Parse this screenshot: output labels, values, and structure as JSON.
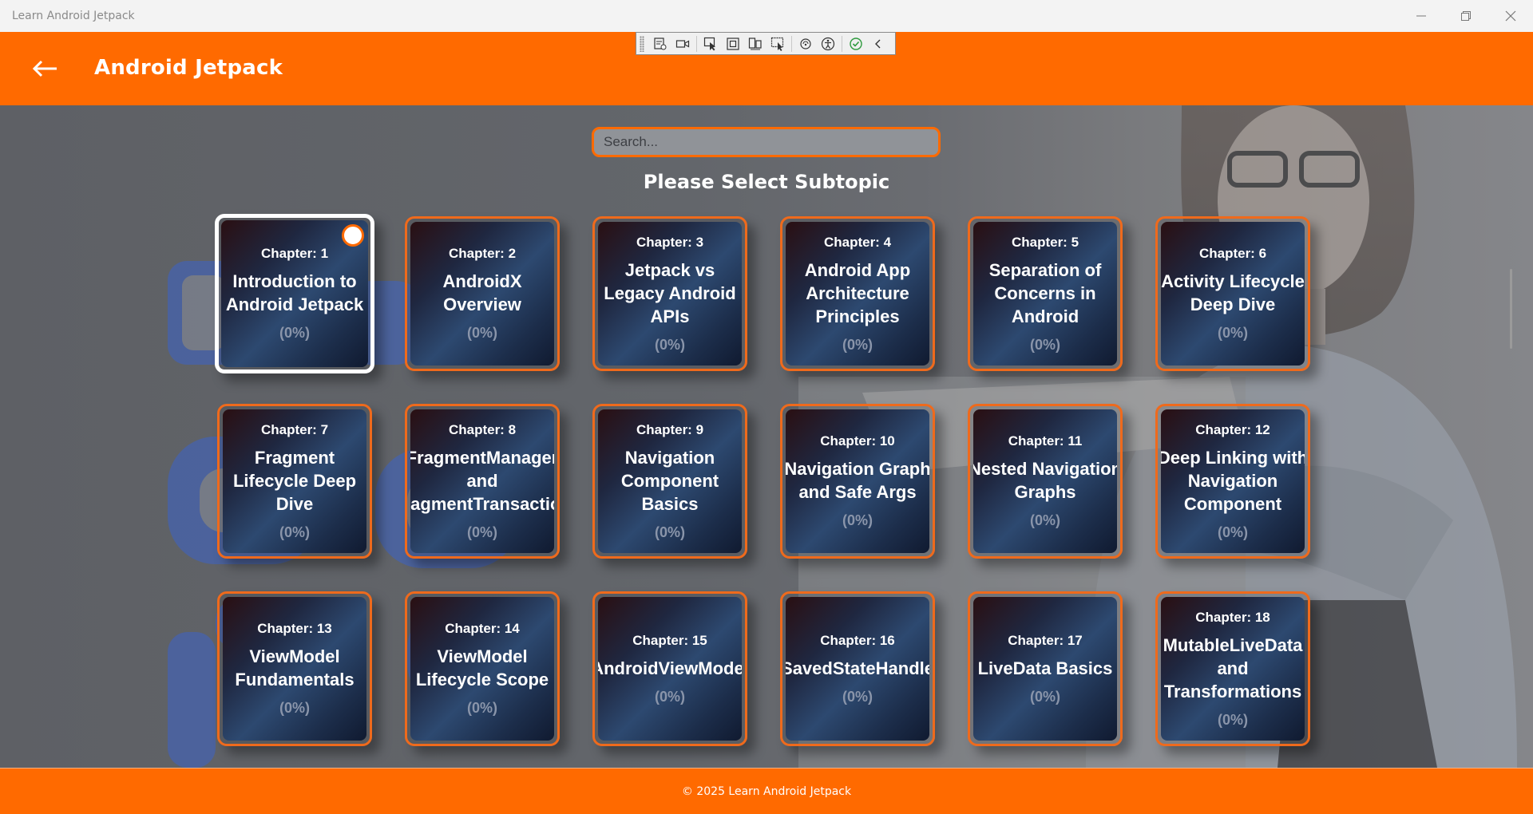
{
  "window": {
    "title": "Learn Android Jetpack",
    "minimize_icon": "minimize-icon",
    "maximize_icon": "restore-icon",
    "close_icon": "close-icon"
  },
  "header": {
    "title": "Android Jetpack",
    "back_icon": "arrow-left-icon"
  },
  "dev_toolbar": {
    "tools": [
      "grip",
      "live-visual-tree-icon",
      "video-icon",
      "select-element-icon",
      "display-layout-adorners-icon",
      "track-focus-icon",
      "preview-selection-icon",
      "binding-failures-icon",
      "accessibility-icon",
      "check-icon",
      "collapse-icon"
    ]
  },
  "search": {
    "placeholder": "Search...",
    "value": ""
  },
  "section_title": "Please Select Subtopic",
  "chapters": [
    {
      "chapter": "Chapter: 1",
      "lines": [
        "Introduction to",
        "Android Jetpack"
      ],
      "progress": "(0%)",
      "selected": true
    },
    {
      "chapter": "Chapter: 2",
      "lines": [
        "AndroidX",
        "Overview"
      ],
      "progress": "(0%)"
    },
    {
      "chapter": "Chapter: 3",
      "lines": [
        "Jetpack vs",
        "Legacy Android",
        "APIs"
      ],
      "progress": "(0%)"
    },
    {
      "chapter": "Chapter: 4",
      "lines": [
        "Android App",
        "Architecture",
        "Principles"
      ],
      "progress": "(0%)"
    },
    {
      "chapter": "Chapter: 5",
      "lines": [
        "Separation of",
        "Concerns in",
        "Android"
      ],
      "progress": "(0%)"
    },
    {
      "chapter": "Chapter: 6",
      "lines": [
        "Activity Lifecycle",
        "Deep Dive"
      ],
      "progress": "(0%)"
    },
    {
      "chapter": "Chapter: 7",
      "lines": [
        "Fragment",
        "Lifecycle Deep",
        "Dive"
      ],
      "progress": "(0%)"
    },
    {
      "chapter": "Chapter: 8",
      "lines": [
        "FragmentManager",
        "and",
        "FragmentTransaction"
      ],
      "progress": "(0%)"
    },
    {
      "chapter": "Chapter: 9",
      "lines": [
        "Navigation",
        "Component",
        "Basics"
      ],
      "progress": "(0%)"
    },
    {
      "chapter": "Chapter: 10",
      "lines": [
        "Navigation Graph",
        "and Safe Args"
      ],
      "progress": "(0%)"
    },
    {
      "chapter": "Chapter: 11",
      "lines": [
        "Nested Navigation",
        "Graphs"
      ],
      "progress": "(0%)"
    },
    {
      "chapter": "Chapter: 12",
      "lines": [
        "Deep Linking with",
        "Navigation",
        "Component"
      ],
      "progress": "(0%)"
    },
    {
      "chapter": "Chapter: 13",
      "lines": [
        "ViewModel",
        "Fundamentals"
      ],
      "progress": "(0%)"
    },
    {
      "chapter": "Chapter: 14",
      "lines": [
        "ViewModel",
        "Lifecycle Scope"
      ],
      "progress": "(0%)"
    },
    {
      "chapter": "Chapter: 15",
      "lines": [
        "AndroidViewModel"
      ],
      "progress": "(0%)"
    },
    {
      "chapter": "Chapter: 16",
      "lines": [
        "SavedStateHandle"
      ],
      "progress": "(0%)"
    },
    {
      "chapter": "Chapter: 17",
      "lines": [
        "LiveData Basics"
      ],
      "progress": "(0%)"
    },
    {
      "chapter": "Chapter: 18",
      "lines": [
        "MutableLiveData",
        "and",
        "Transformations"
      ],
      "progress": "(0%)"
    }
  ],
  "footer": {
    "text": "© 2025 Learn Android Jetpack"
  },
  "colors": {
    "accent": "#ff6a00",
    "card_border": "#ef6a1c",
    "progress_text": "#8a95aa"
  }
}
